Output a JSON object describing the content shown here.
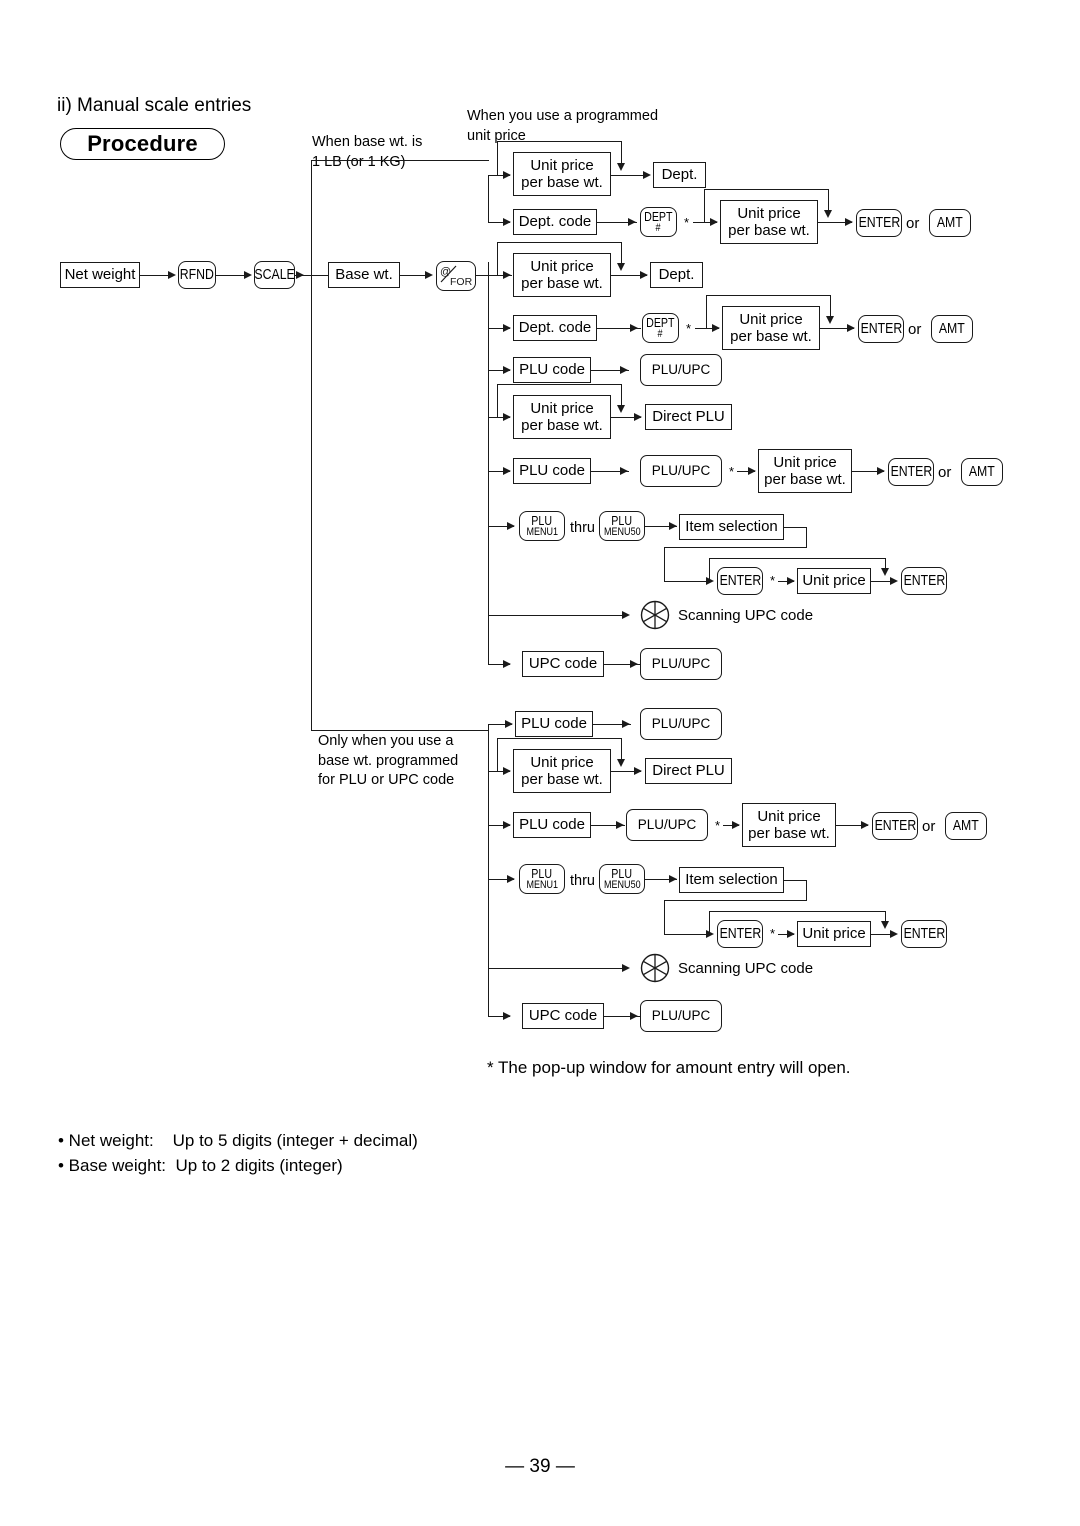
{
  "page": {
    "heading": "ii) Manual scale entries",
    "badge": "Procedure",
    "page_number": "— 39 —"
  },
  "notes": {
    "base_wt_1lb": "When base wt. is\n1 LB (or 1 KG)",
    "programmed_unit_price": "When you use a programmed\nunit price",
    "only_when_base_wt": "Only when you use a\nbase wt. programmed\nfor PLU or UPC code"
  },
  "footnote": "*  The pop-up window for amount entry will open.",
  "specs": [
    "• Net weight:    Up to 5 digits (integer + decimal)",
    "• Base weight:  Up to 2 digits (integer)"
  ],
  "labels": {
    "net_weight": "Net weight",
    "base_wt": "Base wt.",
    "unit_price_l1": "Unit price",
    "unit_price_l2": "per base wt.",
    "unit_price": "Unit price",
    "dept": "Dept.",
    "dept_code": "Dept. code",
    "plu_code": "PLU code",
    "upc_code": "UPC code",
    "direct_plu": "Direct PLU",
    "item_selection": "Item selection",
    "scanning_upc": "Scanning UPC code",
    "thru": "thru",
    "or": "or",
    "star": "*"
  },
  "keys": {
    "rfnd": "RFND",
    "scale": "SCALE",
    "at_for_1": "@",
    "at_for_2": "FOR",
    "dept_hash_1": "DEPT",
    "dept_hash_2": "#",
    "plu_upc": "PLU/UPC",
    "plu_menu_1a": "PLU",
    "plu_menu_1b": "MENU1",
    "plu_menu_50a": "PLU",
    "plu_menu_50b": "MENU50",
    "enter": "ENTER",
    "amt": "AMT"
  },
  "colors": {
    "ink": "#1a1a1a",
    "paper": "#ffffff"
  }
}
